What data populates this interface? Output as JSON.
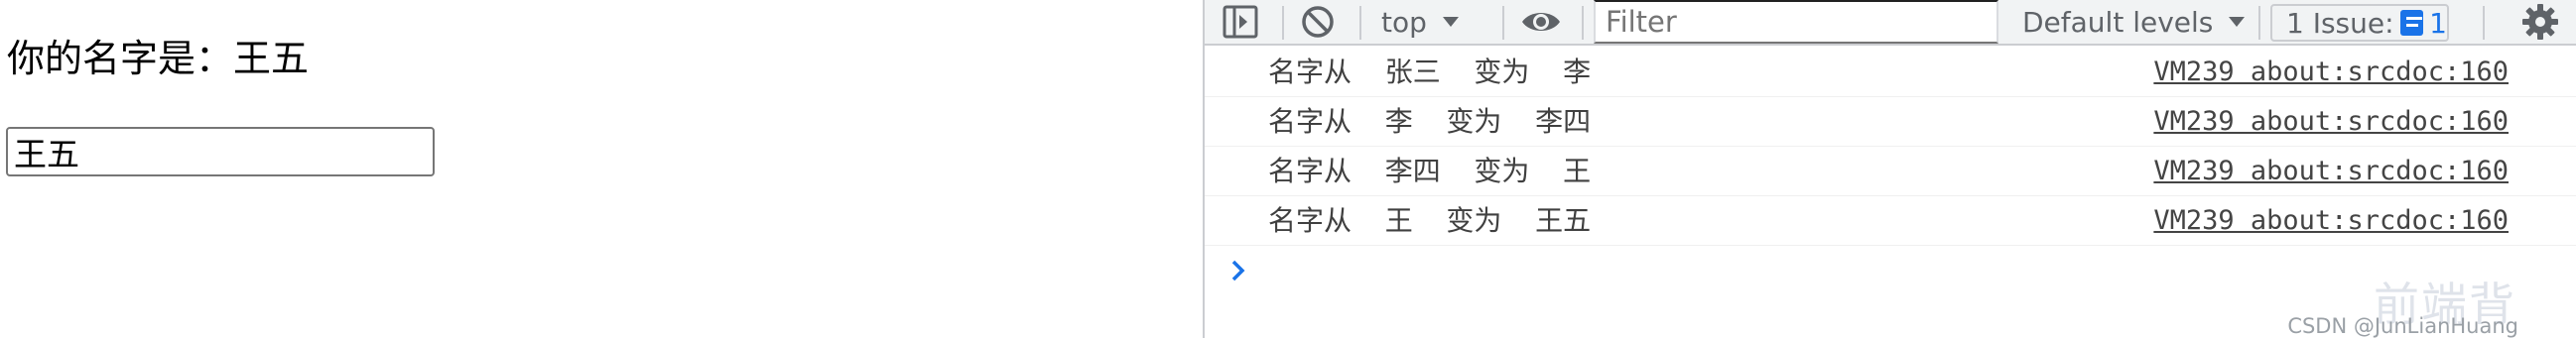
{
  "page": {
    "greeting": "你的名字是：王五",
    "input_value": "王五"
  },
  "toolbar": {
    "context": "top",
    "filter_placeholder": "Filter",
    "levels": "Default levels",
    "issues_label": "1 Issue:",
    "issues_count": "1"
  },
  "console": {
    "rows": [
      {
        "message": "名字从  张三  变为  李",
        "source": "VM239 about:srcdoc:160"
      },
      {
        "message": "名字从  李  变为  李四",
        "source": "VM239 about:srcdoc:160"
      },
      {
        "message": "名字从  李四  变为  王",
        "source": "VM239 about:srcdoc:160"
      },
      {
        "message": "名字从  王  变为  王五",
        "source": "VM239 about:srcdoc:160"
      }
    ]
  },
  "watermark": {
    "logo_text": "前端背",
    "credit": "CSDN @JunLianHuang"
  },
  "colors": {
    "accent": "#1a73e8",
    "toolbar_bg": "#f1f3f4",
    "border": "#cbcdd1"
  }
}
